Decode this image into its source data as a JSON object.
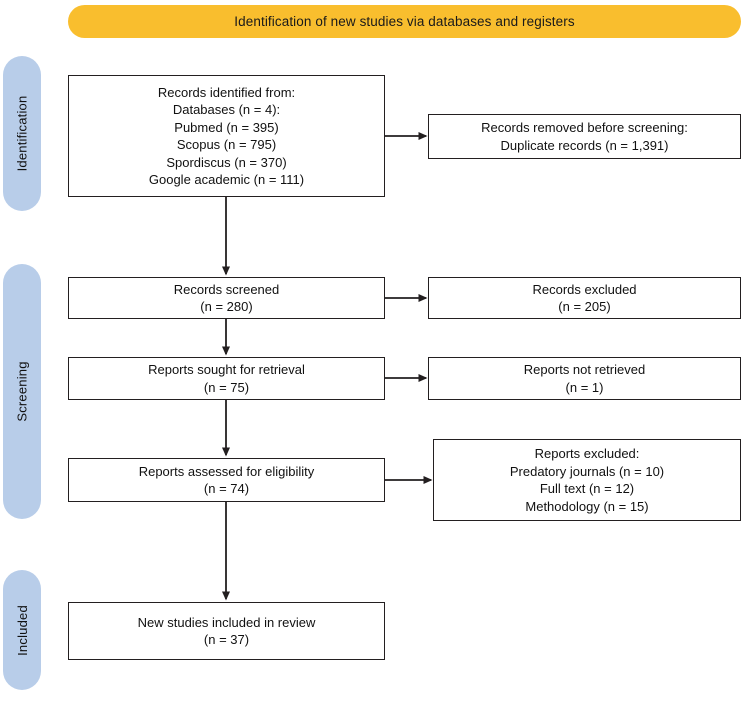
{
  "banner": {
    "title": "Identification of new studies via databases and registers",
    "color": "#F9BE2E"
  },
  "rails": [
    {
      "id": "identification",
      "label": "Identification",
      "color": "#B8CDE9"
    },
    {
      "id": "screening",
      "label": "Screening",
      "color": "#B8CDE9"
    },
    {
      "id": "included",
      "label": "Included",
      "color": "#B8CDE9"
    }
  ],
  "boxes": {
    "identified": {
      "text": "Records identified from:\nDatabases (n = 4):\nPubmed (n = 395)\nScopus (n = 795)\nSpordiscus (n = 370)\nGoogle academic (n = 111)"
    },
    "removed": {
      "text": "Records removed before screening:\nDuplicate records (n = 1,391)"
    },
    "screened": {
      "text": "Records screened\n(n = 280)"
    },
    "excluded_screened": {
      "text": "Records excluded\n(n = 205)"
    },
    "sought": {
      "text": "Reports sought for retrieval\n(n = 75)"
    },
    "not_retrieved": {
      "text": "Reports not retrieved\n(n = 1)"
    },
    "assessed": {
      "text": "Reports assessed for eligibility\n(n = 74)"
    },
    "excluded_eligibility": {
      "text": "Reports excluded:\nPredatory journals (n = 10)\nFull text (n = 12)\nMethodology (n = 15)"
    },
    "included": {
      "text": "New studies included in review\n(n = 37)"
    }
  },
  "chart_data": {
    "type": "diagram",
    "title": "Identification of new studies via databases and registers",
    "stages": [
      "Identification",
      "Screening",
      "Included"
    ],
    "nodes": [
      {
        "id": "identified",
        "stage": "Identification",
        "label": "Records identified from",
        "counts": [
          {
            "source": "Databases",
            "n": 4
          },
          {
            "source": "Pubmed",
            "n": 395
          },
          {
            "source": "Scopus",
            "n": 795
          },
          {
            "source": "Spordiscus",
            "n": 370
          },
          {
            "source": "Google academic",
            "n": 111
          }
        ]
      },
      {
        "id": "removed",
        "stage": "Identification",
        "label": "Records removed before screening",
        "counts": [
          {
            "source": "Duplicate records",
            "n": 1391
          }
        ]
      },
      {
        "id": "screened",
        "stage": "Screening",
        "label": "Records screened",
        "n": 280
      },
      {
        "id": "excluded_screened",
        "stage": "Screening",
        "label": "Records excluded",
        "n": 205
      },
      {
        "id": "sought",
        "stage": "Screening",
        "label": "Reports sought for retrieval",
        "n": 75
      },
      {
        "id": "not_retrieved",
        "stage": "Screening",
        "label": "Reports not retrieved",
        "n": 1
      },
      {
        "id": "assessed",
        "stage": "Screening",
        "label": "Reports assessed for eligibility",
        "n": 74
      },
      {
        "id": "excluded_eligibility",
        "stage": "Screening",
        "label": "Reports excluded",
        "counts": [
          {
            "source": "Predatory journals",
            "n": 10
          },
          {
            "source": "Full text",
            "n": 12
          },
          {
            "source": "Methodology",
            "n": 15
          }
        ]
      },
      {
        "id": "included",
        "stage": "Included",
        "label": "New studies included in review",
        "n": 37
      }
    ],
    "edges": [
      {
        "from": "identified",
        "to": "removed",
        "direction": "right"
      },
      {
        "from": "identified",
        "to": "screened",
        "direction": "down"
      },
      {
        "from": "screened",
        "to": "excluded_screened",
        "direction": "right"
      },
      {
        "from": "screened",
        "to": "sought",
        "direction": "down"
      },
      {
        "from": "sought",
        "to": "not_retrieved",
        "direction": "right"
      },
      {
        "from": "sought",
        "to": "assessed",
        "direction": "down"
      },
      {
        "from": "assessed",
        "to": "excluded_eligibility",
        "direction": "right"
      },
      {
        "from": "assessed",
        "to": "included",
        "direction": "down"
      }
    ]
  }
}
